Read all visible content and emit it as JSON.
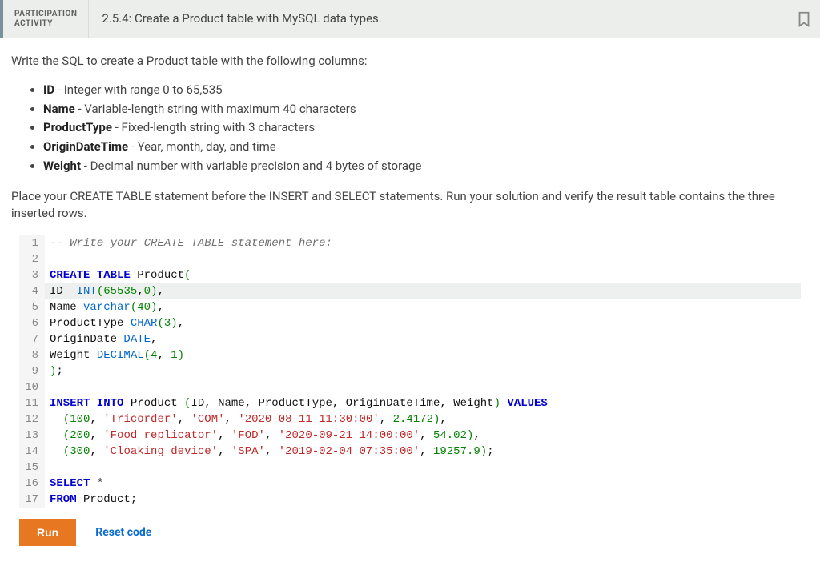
{
  "header": {
    "tag_line1": "PARTICIPATION",
    "tag_line2": "ACTIVITY",
    "title": "2.5.4: Create a Product table with MySQL data types."
  },
  "prompt": {
    "intro": "Write the SQL to create a Product table with the following columns:",
    "columns": [
      {
        "name": "ID",
        "desc": " - Integer with range 0 to 65,535"
      },
      {
        "name": "Name",
        "desc": " - Variable-length string with maximum 40 characters"
      },
      {
        "name": "ProductType",
        "desc": " - Fixed-length string with 3 characters"
      },
      {
        "name": "OriginDateTime",
        "desc": " - Year, month, day, and time"
      },
      {
        "name": "Weight",
        "desc": " - Decimal number with variable precision and 4 bytes of storage"
      }
    ],
    "instructions2": "Place your CREATE TABLE statement before the INSERT and SELECT statements. Run your solution and verify the result table contains the three inserted rows."
  },
  "code": {
    "highlighted_line": 4,
    "lines": [
      [
        {
          "c": "comment",
          "t": "-- Write your CREATE TABLE statement here:"
        }
      ],
      [],
      [
        {
          "c": "keyword",
          "t": "CREATE TABLE"
        },
        {
          "c": "ident",
          "t": " Product"
        },
        {
          "c": "paren",
          "t": "("
        }
      ],
      [
        {
          "c": "ident",
          "t": "ID  "
        },
        {
          "c": "type",
          "t": "INT"
        },
        {
          "c": "paren",
          "t": "("
        },
        {
          "c": "num",
          "t": "65535"
        },
        {
          "c": "punct",
          "t": ","
        },
        {
          "c": "num",
          "t": "0"
        },
        {
          "c": "paren",
          "t": ")"
        },
        {
          "c": "punct",
          "t": ","
        }
      ],
      [
        {
          "c": "ident",
          "t": "Name "
        },
        {
          "c": "type",
          "t": "varchar"
        },
        {
          "c": "paren",
          "t": "("
        },
        {
          "c": "num",
          "t": "40"
        },
        {
          "c": "paren",
          "t": ")"
        },
        {
          "c": "punct",
          "t": ","
        }
      ],
      [
        {
          "c": "ident",
          "t": "ProductType "
        },
        {
          "c": "type",
          "t": "CHAR"
        },
        {
          "c": "paren",
          "t": "("
        },
        {
          "c": "num",
          "t": "3"
        },
        {
          "c": "paren",
          "t": ")"
        },
        {
          "c": "punct",
          "t": ","
        }
      ],
      [
        {
          "c": "ident",
          "t": "OriginDate "
        },
        {
          "c": "type",
          "t": "DATE"
        },
        {
          "c": "punct",
          "t": ","
        }
      ],
      [
        {
          "c": "ident",
          "t": "Weight "
        },
        {
          "c": "type",
          "t": "DECIMAL"
        },
        {
          "c": "paren",
          "t": "("
        },
        {
          "c": "num",
          "t": "4"
        },
        {
          "c": "punct",
          "t": ", "
        },
        {
          "c": "num",
          "t": "1"
        },
        {
          "c": "paren",
          "t": ")"
        }
      ],
      [
        {
          "c": "paren",
          "t": ")"
        },
        {
          "c": "punct",
          "t": ";"
        }
      ],
      [],
      [
        {
          "c": "keyword",
          "t": "INSERT INTO"
        },
        {
          "c": "ident",
          "t": " Product "
        },
        {
          "c": "paren",
          "t": "("
        },
        {
          "c": "ident",
          "t": "ID"
        },
        {
          "c": "punct",
          "t": ", "
        },
        {
          "c": "ident",
          "t": "Name"
        },
        {
          "c": "punct",
          "t": ", "
        },
        {
          "c": "ident",
          "t": "ProductType"
        },
        {
          "c": "punct",
          "t": ", "
        },
        {
          "c": "ident",
          "t": "OriginDateTime"
        },
        {
          "c": "punct",
          "t": ", "
        },
        {
          "c": "ident",
          "t": "Weight"
        },
        {
          "c": "paren",
          "t": ")"
        },
        {
          "c": "keyword",
          "t": " VALUES"
        }
      ],
      [
        {
          "c": "ident",
          "t": "  "
        },
        {
          "c": "paren",
          "t": "("
        },
        {
          "c": "num",
          "t": "100"
        },
        {
          "c": "punct",
          "t": ", "
        },
        {
          "c": "str",
          "t": "'Tricorder'"
        },
        {
          "c": "punct",
          "t": ", "
        },
        {
          "c": "str",
          "t": "'COM'"
        },
        {
          "c": "punct",
          "t": ", "
        },
        {
          "c": "str",
          "t": "'2020-08-11 11:30:00'"
        },
        {
          "c": "punct",
          "t": ", "
        },
        {
          "c": "num",
          "t": "2.4172"
        },
        {
          "c": "paren",
          "t": ")"
        },
        {
          "c": "punct",
          "t": ","
        }
      ],
      [
        {
          "c": "ident",
          "t": "  "
        },
        {
          "c": "paren",
          "t": "("
        },
        {
          "c": "num",
          "t": "200"
        },
        {
          "c": "punct",
          "t": ", "
        },
        {
          "c": "str",
          "t": "'Food replicator'"
        },
        {
          "c": "punct",
          "t": ", "
        },
        {
          "c": "str",
          "t": "'FOD'"
        },
        {
          "c": "punct",
          "t": ", "
        },
        {
          "c": "str",
          "t": "'2020-09-21 14:00:00'"
        },
        {
          "c": "punct",
          "t": ", "
        },
        {
          "c": "num",
          "t": "54.02"
        },
        {
          "c": "paren",
          "t": ")"
        },
        {
          "c": "punct",
          "t": ","
        }
      ],
      [
        {
          "c": "ident",
          "t": "  "
        },
        {
          "c": "paren",
          "t": "("
        },
        {
          "c": "num",
          "t": "300"
        },
        {
          "c": "punct",
          "t": ", "
        },
        {
          "c": "str",
          "t": "'Cloaking device'"
        },
        {
          "c": "punct",
          "t": ", "
        },
        {
          "c": "str",
          "t": "'SPA'"
        },
        {
          "c": "punct",
          "t": ", "
        },
        {
          "c": "str",
          "t": "'2019-02-04 07:35:00'"
        },
        {
          "c": "punct",
          "t": ", "
        },
        {
          "c": "num",
          "t": "19257.9"
        },
        {
          "c": "paren",
          "t": ")"
        },
        {
          "c": "punct",
          "t": ";"
        }
      ],
      [],
      [
        {
          "c": "keyword",
          "t": "SELECT"
        },
        {
          "c": "ident",
          "t": " *"
        }
      ],
      [
        {
          "c": "keyword",
          "t": "FROM"
        },
        {
          "c": "ident",
          "t": " Product"
        },
        {
          "c": "punct",
          "t": ";"
        }
      ]
    ]
  },
  "actions": {
    "run": "Run",
    "reset": "Reset code"
  }
}
